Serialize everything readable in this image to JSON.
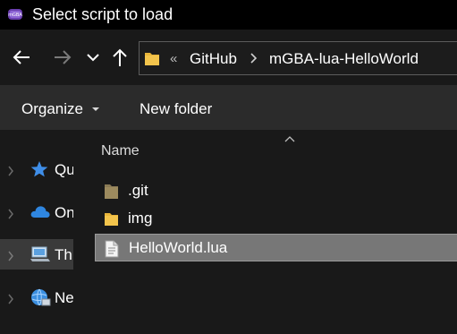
{
  "window": {
    "title": "Select script to load"
  },
  "nav": {
    "back_icon": "arrow-left-icon",
    "forward_icon": "arrow-right-icon",
    "recent_icon": "chevron-down-icon",
    "up_icon": "arrow-up-icon"
  },
  "address": {
    "overflow": "«",
    "segments": [
      "GitHub",
      "mGBA-lua-HelloWorld"
    ]
  },
  "toolbar": {
    "organize_label": "Organize",
    "new_folder_label": "New folder"
  },
  "sidebar": {
    "items": [
      {
        "label": "Qu",
        "icon": "star-icon"
      },
      {
        "label": "On",
        "icon": "cloud-icon"
      },
      {
        "label": "Th",
        "icon": "computer-icon",
        "selected": true
      },
      {
        "label": "Ne",
        "icon": "network-icon"
      }
    ]
  },
  "files": {
    "column_name": "Name",
    "items": [
      {
        "name": ".git",
        "type": "hidden-folder"
      },
      {
        "name": "img",
        "type": "folder"
      },
      {
        "name": "HelloWorld.lua",
        "type": "file",
        "selected": true
      }
    ]
  },
  "colors": {
    "titlebar": "#000000",
    "background": "#191919",
    "toolbar": "#2b2b2b",
    "selection": "#777777",
    "folder": "#f3c44c"
  }
}
